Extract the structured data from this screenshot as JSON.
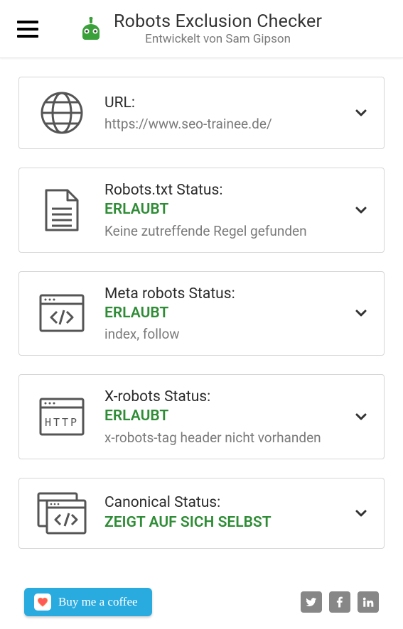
{
  "header": {
    "title": "Robots Exclusion Checker",
    "subtitle": "Entwickelt von Sam Gipson"
  },
  "colors": {
    "allowed": "#2f8c36"
  },
  "cards": [
    {
      "icon": "globe",
      "title": "URL:",
      "status": "",
      "detail": "https://www.seo-trainee.de/"
    },
    {
      "icon": "file",
      "title": "Robots.txt Status:",
      "status": "ERLAUBT",
      "detail": "Keine zutreffende Regel gefunden"
    },
    {
      "icon": "code",
      "title": "Meta robots Status:",
      "status": "ERLAUBT",
      "detail": "index, follow"
    },
    {
      "icon": "http",
      "title": "X-robots Status:",
      "status": "ERLAUBT",
      "detail": "x-robots-tag header nicht vorhanden"
    },
    {
      "icon": "canonical",
      "title": "Canonical Status:",
      "status": "ZEIGT AUF SICH SELBST",
      "detail": ""
    }
  ],
  "footer": {
    "coffee_label": "Buy me a coffee",
    "socials": [
      "twitter",
      "facebook",
      "linkedin"
    ]
  }
}
